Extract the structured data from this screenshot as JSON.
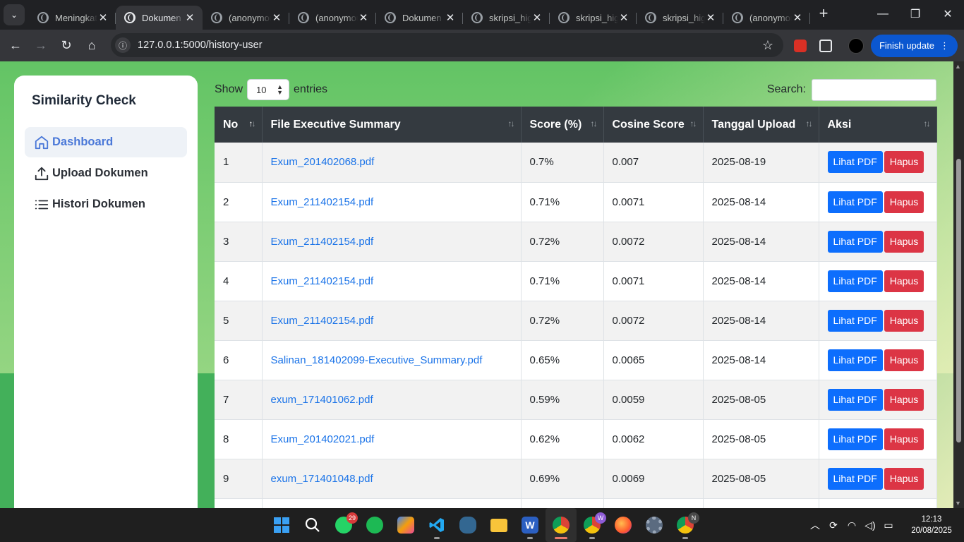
{
  "browser": {
    "tabs": [
      {
        "title": "Meningkatkan",
        "active": false
      },
      {
        "title": "Dokumen",
        "active": true
      },
      {
        "title": "(anonymous)",
        "active": false
      },
      {
        "title": "(anonymous)",
        "active": false
      },
      {
        "title": "Dokumen",
        "active": false
      },
      {
        "title": "skripsi_hig",
        "active": false
      },
      {
        "title": "skripsi_hig",
        "active": false
      },
      {
        "title": "skripsi_hig",
        "active": false
      },
      {
        "title": "(anonymous)",
        "active": false
      }
    ],
    "url": "127.0.0.1:5000/history-user",
    "finish_update_label": "Finish update"
  },
  "sidebar": {
    "brand": "Similarity Check",
    "items": [
      {
        "label": "Dashboard",
        "icon": "home-icon",
        "active": true
      },
      {
        "label": "Upload Dokumen",
        "icon": "upload-icon",
        "active": false
      },
      {
        "label": "Histori Dokumen",
        "icon": "list-icon",
        "active": false
      }
    ]
  },
  "table_controls": {
    "show_label": "Show",
    "entries_value": "10",
    "entries_label": "entries",
    "search_label": "Search:",
    "search_value": ""
  },
  "table": {
    "columns": [
      "No",
      "File Executive Summary",
      "Score (%)",
      "Cosine Score",
      "Tanggal Upload",
      "Aksi"
    ],
    "view_label": "Lihat PDF",
    "delete_label": "Hapus",
    "rows": [
      {
        "no": "1",
        "file": "Exum_201402068.pdf",
        "score": "0.7%",
        "cosine": "0.007",
        "date": "2025-08-19"
      },
      {
        "no": "2",
        "file": "Exum_211402154.pdf",
        "score": "0.71%",
        "cosine": "0.0071",
        "date": "2025-08-14"
      },
      {
        "no": "3",
        "file": "Exum_211402154.pdf",
        "score": "0.72%",
        "cosine": "0.0072",
        "date": "2025-08-14"
      },
      {
        "no": "4",
        "file": "Exum_211402154.pdf",
        "score": "0.71%",
        "cosine": "0.0071",
        "date": "2025-08-14"
      },
      {
        "no": "5",
        "file": "Exum_211402154.pdf",
        "score": "0.72%",
        "cosine": "0.0072",
        "date": "2025-08-14"
      },
      {
        "no": "6",
        "file": "Salinan_181402099-Executive_Summary.pdf",
        "score": "0.65%",
        "cosine": "0.0065",
        "date": "2025-08-14"
      },
      {
        "no": "7",
        "file": "exum_171401062.pdf",
        "score": "0.59%",
        "cosine": "0.0059",
        "date": "2025-08-05"
      },
      {
        "no": "8",
        "file": "Exum_201402021.pdf",
        "score": "0.62%",
        "cosine": "0.0062",
        "date": "2025-08-05"
      },
      {
        "no": "9",
        "file": "exum_171401048.pdf",
        "score": "0.69%",
        "cosine": "0.0069",
        "date": "2025-08-05"
      },
      {
        "no": "",
        "file": "",
        "score": "",
        "cosine": "",
        "date": ""
      }
    ]
  },
  "taskbar": {
    "whatsapp_badge": "29",
    "chrome_w_badge": "W",
    "chrome_n_badge": "N",
    "time": "12:13",
    "date": "20/08/2025"
  }
}
